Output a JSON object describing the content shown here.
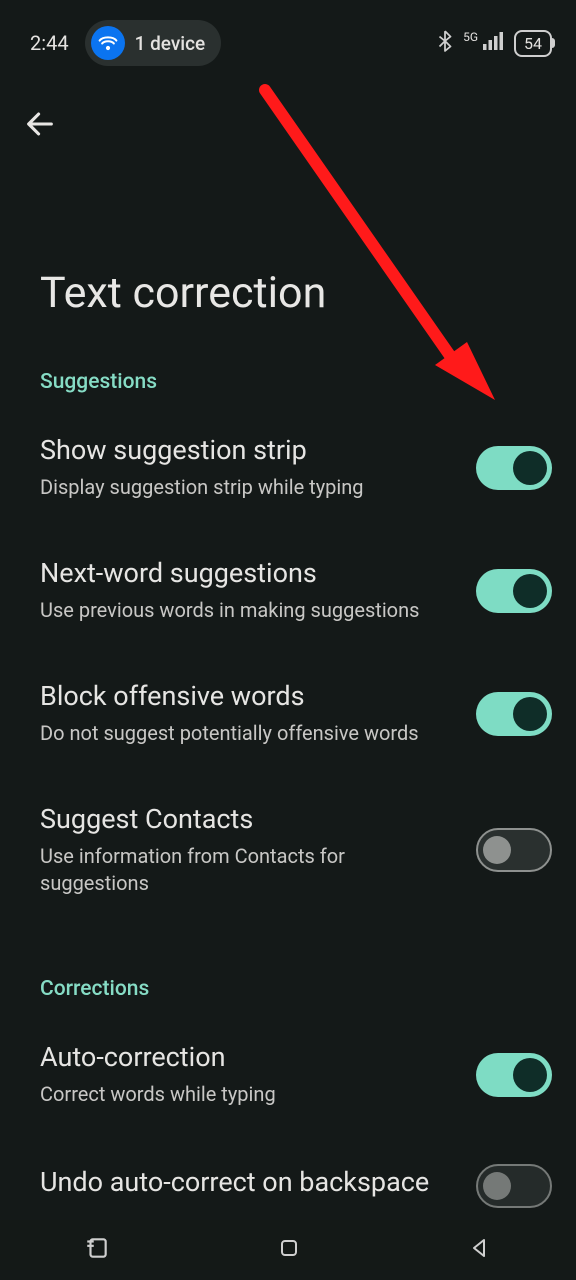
{
  "status": {
    "time": "2:44",
    "device_chip_label": "1 device",
    "network_label": "5G",
    "battery_label": "54"
  },
  "page": {
    "title": "Text correction"
  },
  "sections": {
    "suggestions_header": "Suggestions",
    "corrections_header": "Corrections"
  },
  "settings": {
    "show_suggestion_strip": {
      "label": "Show suggestion strip",
      "caption": "Display suggestion strip while typing"
    },
    "next_word": {
      "label": "Next-word suggestions",
      "caption": "Use previous words in making suggestions"
    },
    "block_offensive": {
      "label": "Block offensive words",
      "caption": "Do not suggest potentially offensive words"
    },
    "suggest_contacts": {
      "label": "Suggest Contacts",
      "caption": "Use information from Contacts for suggestions"
    },
    "auto_correction": {
      "label": "Auto-correction",
      "caption": "Correct words while typing"
    },
    "undo_autocorrect": {
      "label": "Undo auto-correct on backspace"
    }
  }
}
